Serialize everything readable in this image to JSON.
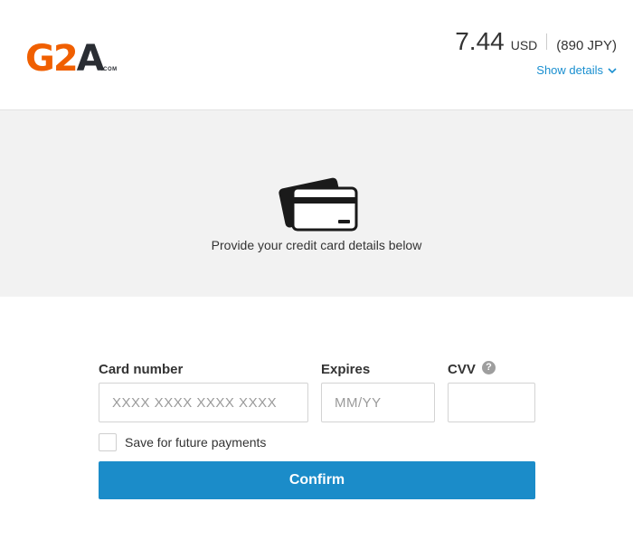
{
  "header": {
    "logo_text_main": "G2",
    "logo_text_accent": "A",
    "logo_sub": ".COM",
    "price_amount": "7.44",
    "price_currency": "USD",
    "price_alt": "(890 JPY)",
    "show_details_label": "Show details"
  },
  "info": {
    "message": "Provide your credit card details below"
  },
  "form": {
    "card_number_label": "Card number",
    "card_number_placeholder": "XXXX XXXX XXXX XXXX",
    "expires_label": "Expires",
    "expires_placeholder": "MM/YY",
    "cvv_label": "CVV",
    "cvv_help": "?",
    "save_label": "Save for future payments",
    "confirm_label": "Confirm"
  },
  "colors": {
    "brand_orange": "#f05f00",
    "accent_blue": "#1b8cc9",
    "link_blue": "#1a8fd0"
  },
  "icons": {
    "chevron": "chevron-down-icon",
    "cards": "credit-card-icon",
    "help": "question-circle-icon"
  }
}
